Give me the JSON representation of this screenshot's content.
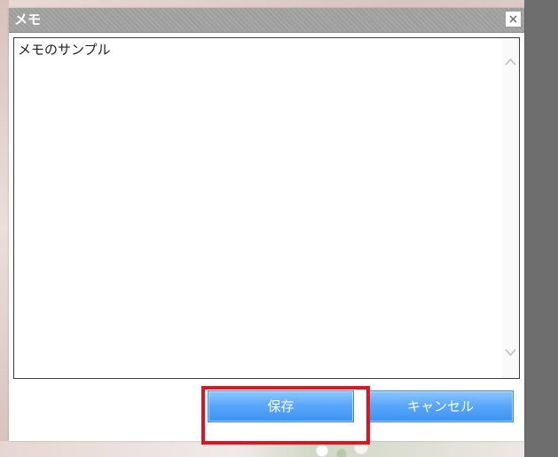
{
  "dialog": {
    "title": "メモ",
    "memo_text": "メモのサンプル",
    "save_label": "保存",
    "cancel_label": "キャンセル"
  },
  "icons": {
    "close": "close-icon",
    "scroll_up": "chevron-up-icon",
    "scroll_down": "chevron-down-icon"
  },
  "colors": {
    "button_blue": "#4a9ef7",
    "highlight_red": "#e0141e",
    "titlebar_gray": "#a2a2a2"
  }
}
